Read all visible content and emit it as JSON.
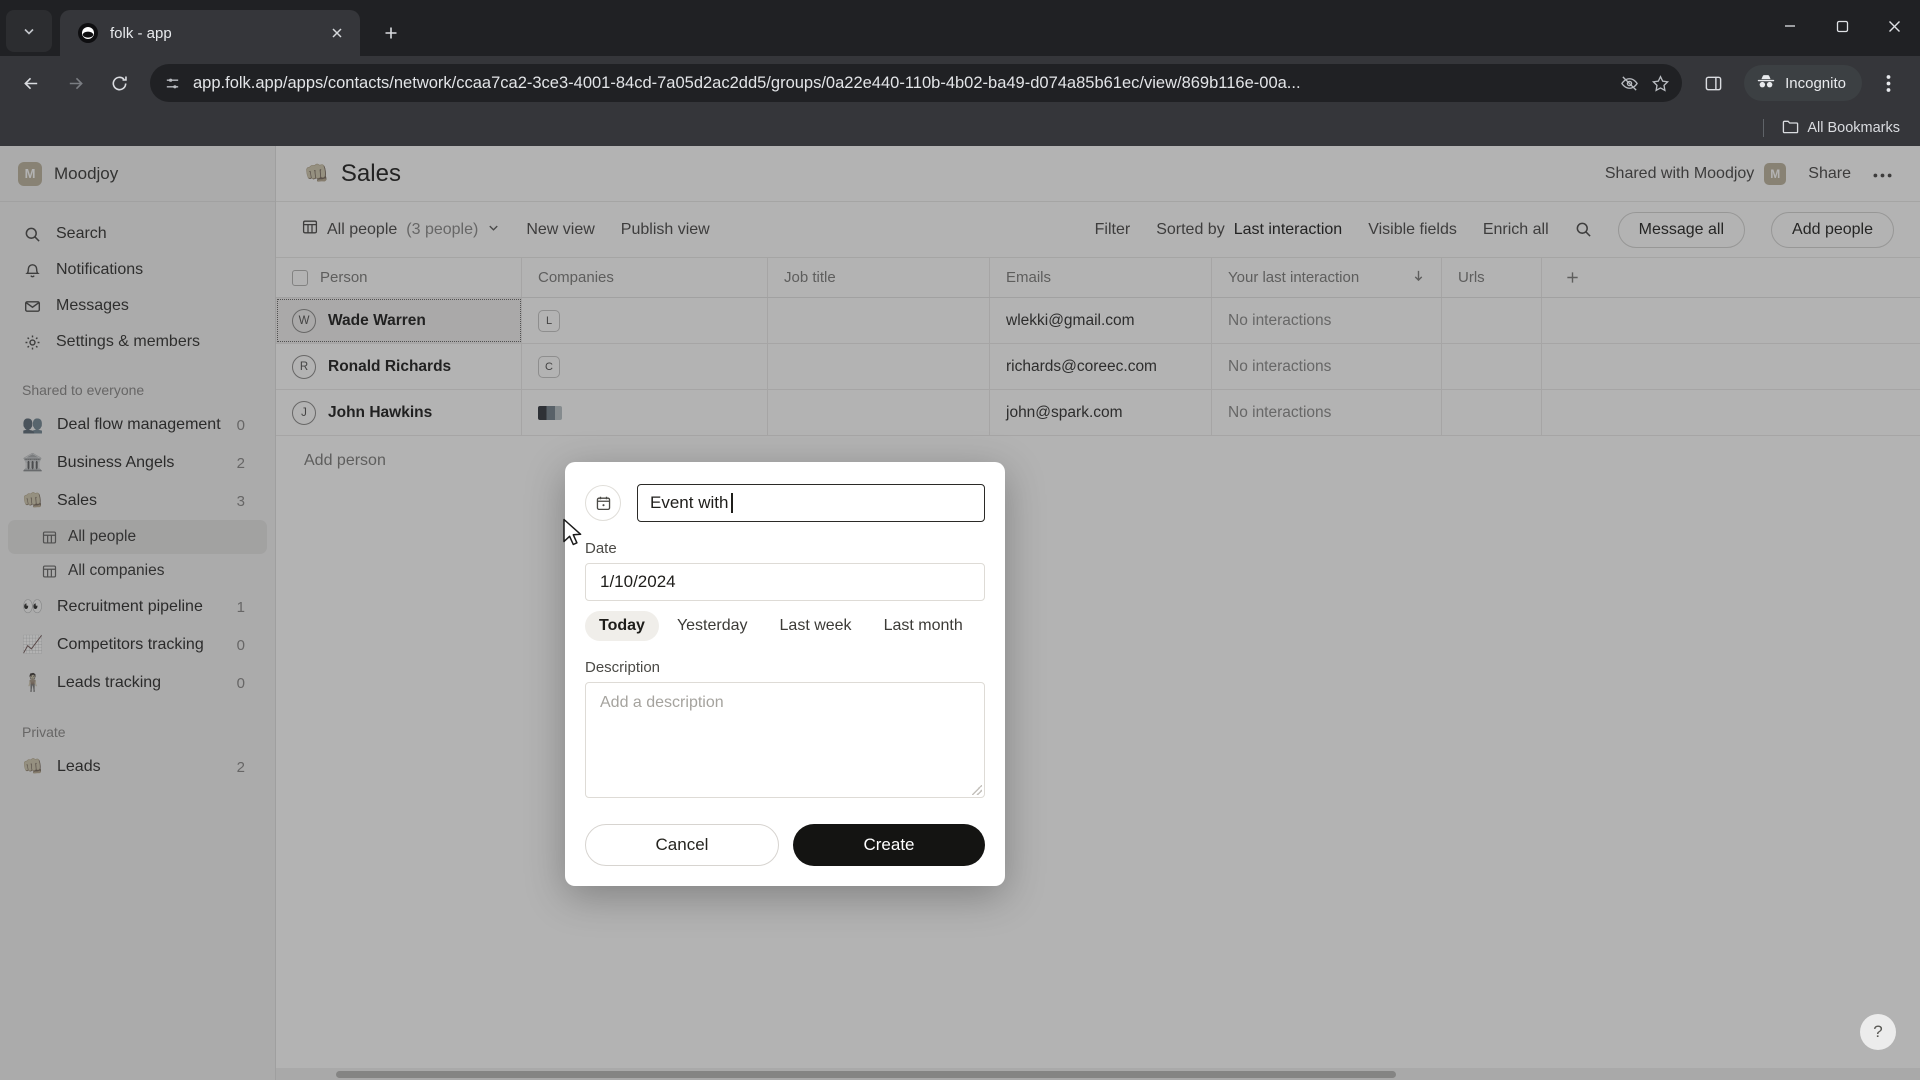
{
  "browser": {
    "tab": {
      "title": "folk - app",
      "favicon_icon": "folk-logo-icon",
      "close_icon": "close-icon"
    },
    "tab_list_icon": "chevron-down-icon",
    "new_tab_icon": "plus-icon",
    "window": {
      "minimize_icon": "minimize-icon",
      "maximize_icon": "maximize-icon",
      "close_icon": "window-close-icon"
    },
    "nav": {
      "back_icon": "back-arrow-icon",
      "forward_icon": "forward-arrow-icon",
      "reload_icon": "reload-icon"
    },
    "omnibox": {
      "site_info_icon": "site-settings-icon",
      "url": "app.folk.app/apps/contacts/network/ccaa7ca2-3ce3-4001-84cd-7a05d2ac2dd5/groups/0a22e440-110b-4b02-ba49-d074a85b61ec/view/869b116e-00a...",
      "tracking_icon": "eye-crossed-icon",
      "bookmark_icon": "star-icon"
    },
    "side_panel_icon": "side-panel-icon",
    "incognito": {
      "label": "Incognito",
      "icon": "incognito-icon"
    },
    "menu_icon": "three-dot-menu-icon",
    "bookmarks_bar": {
      "label": "All Bookmarks",
      "icon": "folder-icon"
    }
  },
  "sidebar": {
    "workspace": {
      "name": "Moodjoy",
      "initial": "M"
    },
    "nav_items": [
      {
        "label": "Search",
        "icon": "search-icon"
      },
      {
        "label": "Notifications",
        "icon": "bell-icon"
      },
      {
        "label": "Messages",
        "icon": "envelope-icon"
      },
      {
        "label": "Settings & members",
        "icon": "gear-icon"
      }
    ],
    "shared_section_label": "Shared to everyone",
    "shared_groups": [
      {
        "label": "Deal flow management",
        "count": "0",
        "emoji": "👥"
      },
      {
        "label": "Business Angels",
        "count": "2",
        "emoji": "🏛️"
      },
      {
        "label": "Sales",
        "count": "3",
        "emoji": "👊"
      },
      {
        "label": "Recruitment pipeline",
        "count": "1",
        "emoji": "👀"
      },
      {
        "label": "Competitors tracking",
        "count": "0",
        "emoji": "📈"
      },
      {
        "label": "Leads tracking",
        "count": "0",
        "emoji": "🧍"
      }
    ],
    "sales_subitems": [
      {
        "label": "All people",
        "icon": "table-icon",
        "active": true
      },
      {
        "label": "All companies",
        "icon": "table-icon",
        "active": false
      }
    ],
    "private_section_label": "Private",
    "private_groups": [
      {
        "label": "Leads",
        "count": "2",
        "emoji": "👊"
      }
    ]
  },
  "header": {
    "title": "Sales",
    "emoji": "👊",
    "shared_with": "Shared with Moodjoy",
    "shared_avatar": "M",
    "share_label": "Share",
    "more_icon": "three-dot-menu-icon"
  },
  "view_bar": {
    "view_icon": "table-icon",
    "view_name": "All people",
    "view_count": "(3 people)",
    "view_chevron_icon": "chevron-down-icon",
    "new_view": "New view",
    "publish_view": "Publish view",
    "filter": "Filter",
    "sorted_by_prefix": "Sorted by",
    "sorted_by_field": "Last interaction",
    "visible_fields": "Visible fields",
    "enrich_all": "Enrich all",
    "search_icon": "search-icon",
    "message_all": "Message all",
    "add_people": "Add people"
  },
  "table": {
    "columns": [
      "Person",
      "Companies",
      "Job title",
      "Emails",
      "Your last interaction",
      "Urls"
    ],
    "sort_indicator_icon": "arrow-down-icon",
    "add_column_icon": "plus-icon",
    "rows": [
      {
        "person": "Wade Warren",
        "initial": "W",
        "company_chip": "L",
        "job_title": "",
        "email": "wlekki@gmail.com",
        "last_interaction": "No interactions",
        "url": "",
        "selected": true
      },
      {
        "person": "Ronald Richards",
        "initial": "R",
        "company_chip": "C",
        "job_title": "",
        "email": "richards@coreec.com",
        "last_interaction": "No interactions",
        "url": "",
        "selected": false
      },
      {
        "person": "John Hawkins",
        "initial": "J",
        "company_chip": "",
        "job_title": "",
        "email": "john@spark.com",
        "last_interaction": "No interactions",
        "url": "",
        "selected": false
      }
    ],
    "add_person_label": "Add person"
  },
  "modal": {
    "calendar_icon": "calendar-icon",
    "title_value": "Event with",
    "date_label": "Date",
    "date_value": "1/10/2024",
    "quick_dates": [
      {
        "label": "Today",
        "selected": true
      },
      {
        "label": "Yesterday",
        "selected": false
      },
      {
        "label": "Last week",
        "selected": false
      },
      {
        "label": "Last month",
        "selected": false
      }
    ],
    "description_label": "Description",
    "description_placeholder": "Add a description",
    "cancel_label": "Cancel",
    "create_label": "Create"
  },
  "help": {
    "icon": "question-mark-icon",
    "label": "?"
  },
  "colors": {
    "brand_yellow": "#e8b422",
    "modal_primary": "#141412"
  }
}
